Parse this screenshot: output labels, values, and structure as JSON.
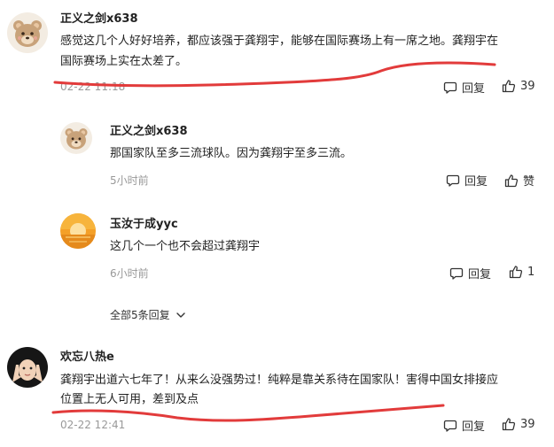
{
  "colors": {
    "text": "#222222",
    "muted": "#999999",
    "annotation": "#e23b3b",
    "bear_fur": "#c8a27a",
    "sun_orange": "#f4a028"
  },
  "comments": [
    {
      "user": "正义之剑x638",
      "avatar_icon": "bear-avatar-icon",
      "lines": [
        "感觉这几个人好好培养，都应该强于龚翔宇，能够在国际赛场上有一席之地。龚翔宇在",
        "国际赛场上实在太差了。"
      ],
      "time": "02-22 11:18",
      "reply_label": "回复",
      "like_count": "39",
      "replies": [
        {
          "user": "正义之剑x638",
          "avatar_icon": "bear-avatar-icon",
          "text": "那国家队至多三流球队。因为龚翔宇至多三流。",
          "time": "5小时前",
          "reply_label": "回复",
          "like_label": "赞"
        },
        {
          "user": "玉汝于成yyc",
          "avatar_icon": "sunset-avatar-icon",
          "text": "这几个一个也不会超过龚翔宇",
          "time": "6小时前",
          "reply_label": "回复",
          "like_count": "1"
        }
      ],
      "more_replies_label": "全部5条回复"
    },
    {
      "user": "欢忘八热e",
      "avatar_icon": "hands-face-avatar-icon",
      "lines": [
        "龚翔宇出道六七年了！从来么没强势过！纯粹是靠关系待在国家队！害得中国女排接应",
        "位置上无人可用，差到及点"
      ],
      "time": "02-22 12:41",
      "reply_label": "回复",
      "like_count": "39"
    }
  ]
}
